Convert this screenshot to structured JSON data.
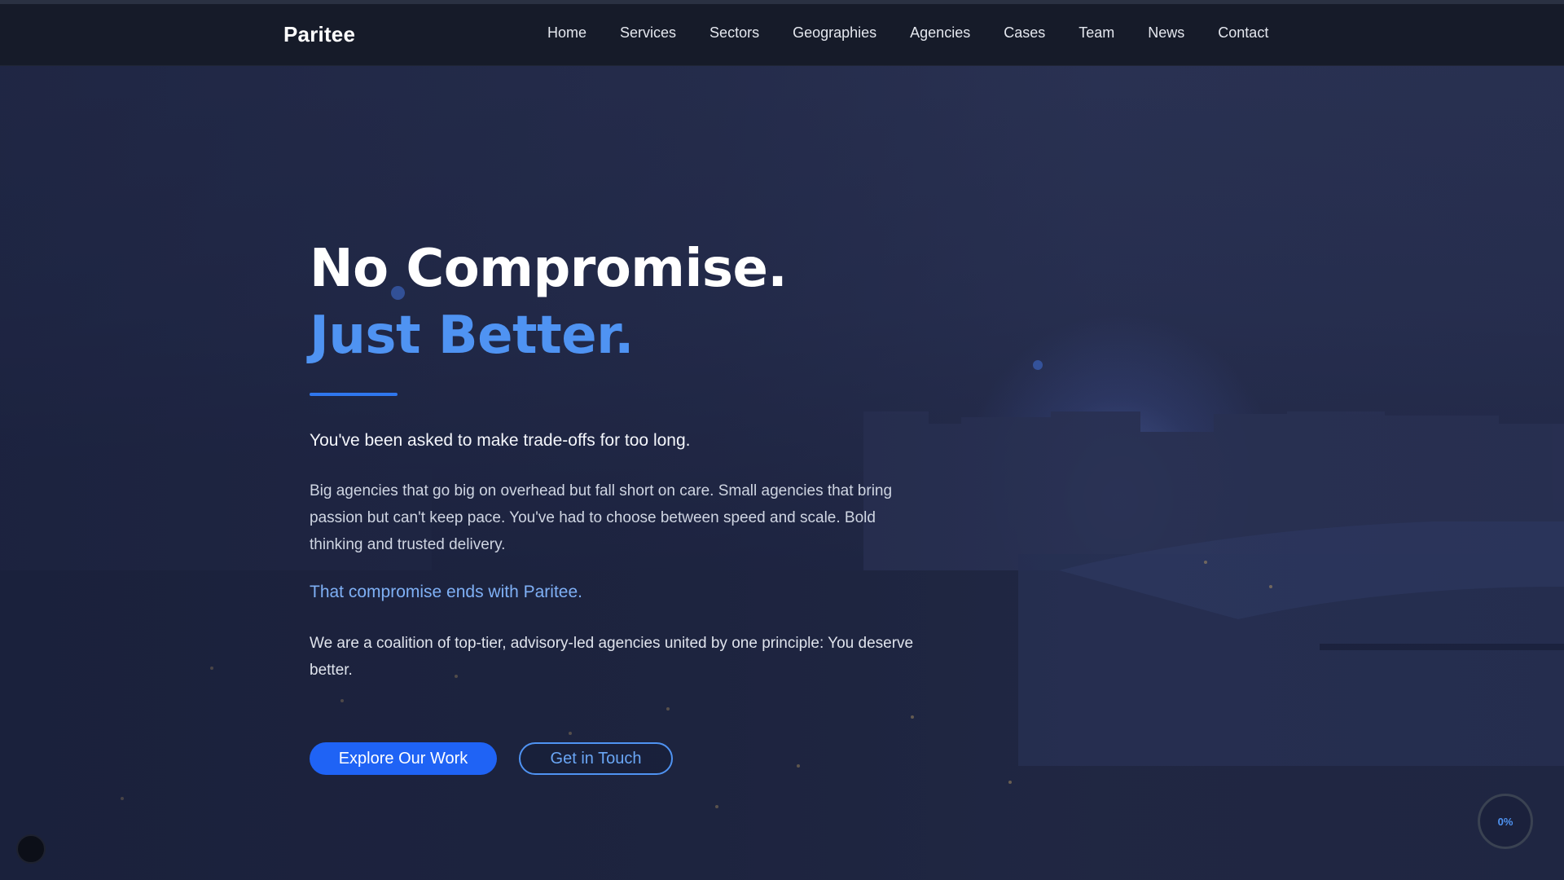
{
  "brand": {
    "name": "Paritee"
  },
  "nav": {
    "items": [
      {
        "label": "Home"
      },
      {
        "label": "Services"
      },
      {
        "label": "Sectors"
      },
      {
        "label": "Geographies"
      },
      {
        "label": "Agencies"
      },
      {
        "label": "Cases"
      },
      {
        "label": "Team"
      },
      {
        "label": "News"
      },
      {
        "label": "Contact"
      }
    ]
  },
  "hero": {
    "title_line1": "No Compromise.",
    "title_line2": "Just Better.",
    "lead": "You've been asked to make trade-offs for too long.",
    "body": "Big agencies that go big on overhead but fall short on care. Small agencies that bring passion but can't keep pace. You've had to choose between speed and scale. Bold thinking and trusted delivery.",
    "highlight": "That compromise ends with Paritee.",
    "body2": "We are a coalition of top-tier, advisory-led agencies united by one principle: You deserve better."
  },
  "cta": {
    "primary_label": "Explore Our Work",
    "secondary_label": "Get in Touch"
  },
  "scroll_progress": {
    "label": "0%",
    "value": 0
  },
  "colors": {
    "accent": "#4f93f2",
    "button_primary": "#1f63f5",
    "navbar_bg": "#161b29"
  }
}
